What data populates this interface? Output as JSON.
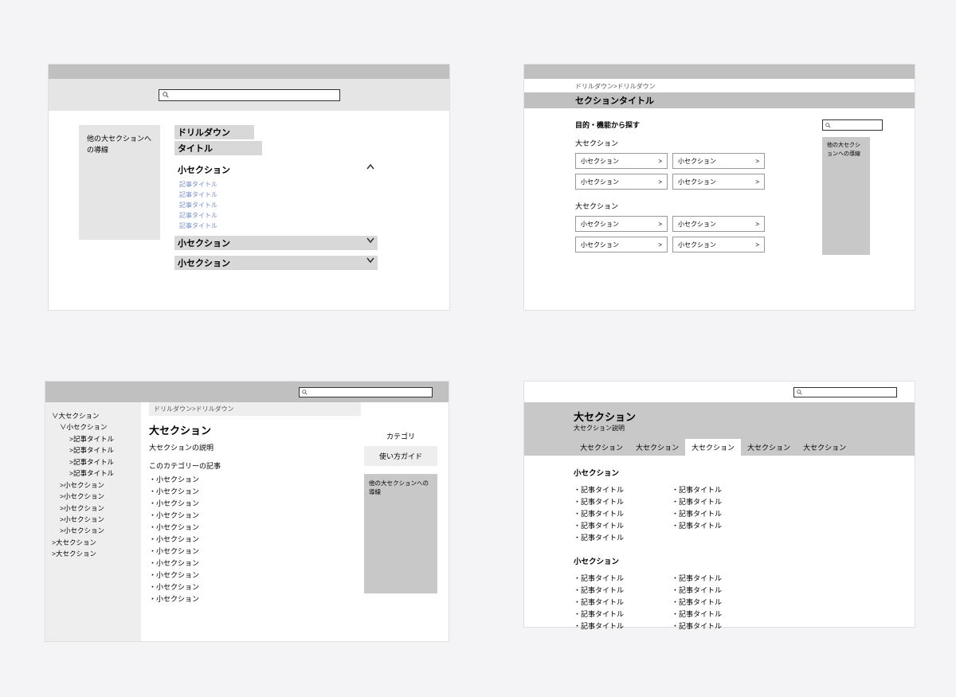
{
  "frame1": {
    "sidebar": "他の大セクションへの導線",
    "drill": "ドリルダウン",
    "title": "タイトル",
    "sec_open": "小セクション",
    "links": [
      "記事タイトル",
      "記事タイトル",
      "記事タイトル",
      "記事タイトル",
      "記事タイトル"
    ],
    "sec_closed1": "小セクション",
    "sec_closed2": "小セクション"
  },
  "frame2": {
    "breadcrumb": "ドリルダウン>ドリルダウン",
    "title": "セクションタイトル",
    "search_label": "目的・機能から探す",
    "big1": "大セクション",
    "big2": "大セクション",
    "small": "小セクション",
    "arrow": ">",
    "sidebar": "他の大セクションへの導線"
  },
  "frame3": {
    "nav": {
      "s1": "∨大セクション",
      "s1a": "∨小セクション",
      "art": ">記事タイトル",
      "sub": ">小セクション",
      "big": ">大セクション"
    },
    "breadcrumb": "ドリルダウン>ドリルダウン",
    "title": "大セクション",
    "desc": "大セクションの説明",
    "list_label": "このカテゴリーの記事",
    "item": "・小セクション",
    "cat": "カテゴリ",
    "guide": "使い方ガイド",
    "panel": "他の大セクションへの導線"
  },
  "frame4": {
    "title": "大セクション",
    "desc": "大セクション説明",
    "tab": "大セクション",
    "sec": "小セクション",
    "art": "・記事タイトル"
  }
}
